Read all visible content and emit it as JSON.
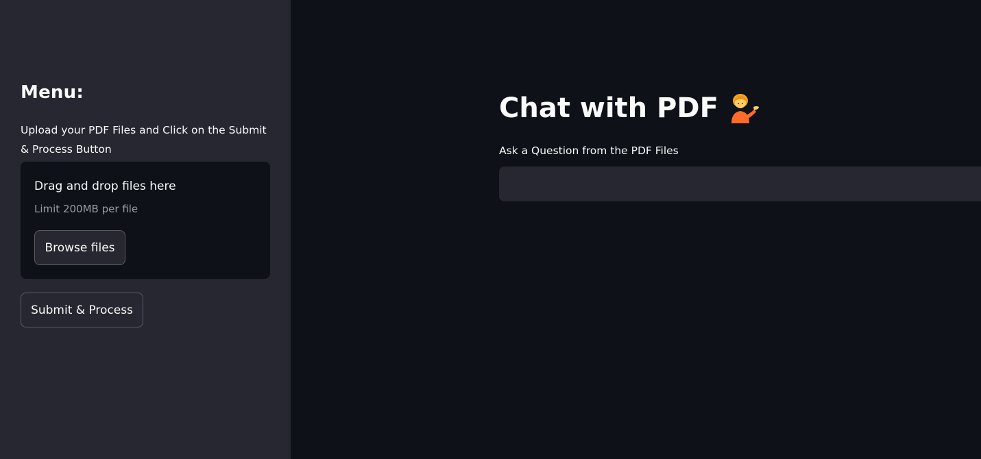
{
  "sidebar": {
    "title": "Menu:",
    "description": "Upload your PDF Files and Click on the Submit & Process Button",
    "uploader": {
      "drag_text": "Drag and drop files here",
      "limit_text": "Limit 200MB per file",
      "browse_label": "Browse files"
    },
    "submit_label": "Submit & Process"
  },
  "main": {
    "title": "Chat with PDF",
    "title_icon": "person-tipping-hand-icon",
    "question": {
      "label": "Ask a Question from the PDF Files",
      "value": ""
    }
  },
  "colors": {
    "background": "#0e1117",
    "sidebar_background": "#262730",
    "text": "#fafafa",
    "muted_text": "#9a9ca3",
    "input_background": "#262730"
  }
}
